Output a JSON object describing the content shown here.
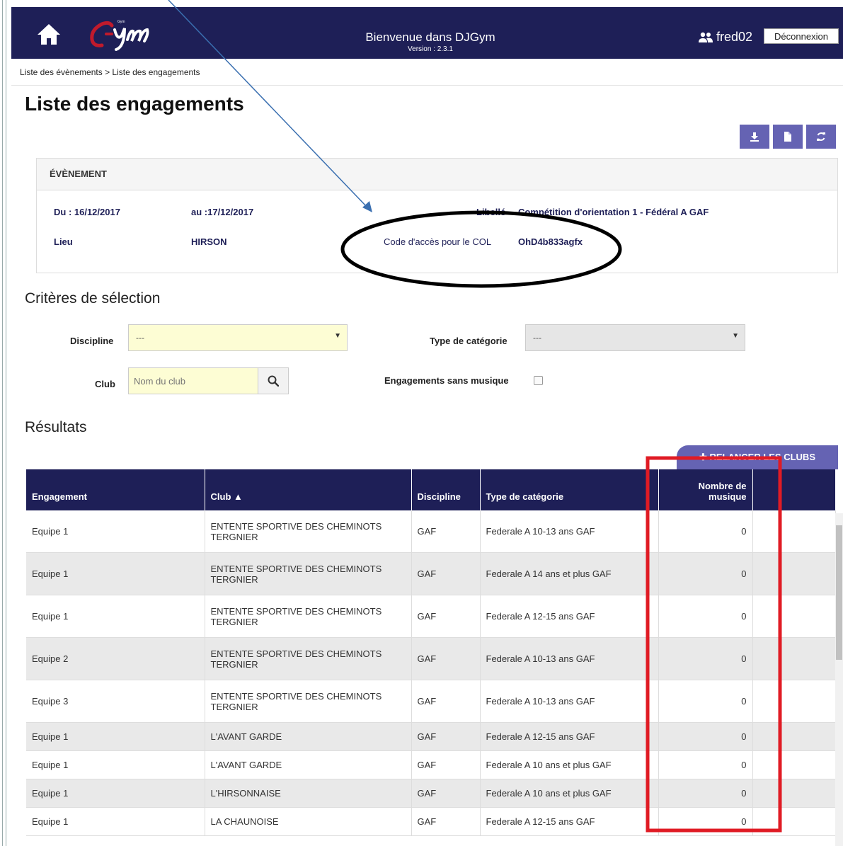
{
  "header": {
    "title": "Bienvenue dans DJGym",
    "version": "Version : 2.3.1",
    "logo_text": "Gym",
    "user": "fred02",
    "logout_label": "Déconnexion"
  },
  "breadcrumb": "Liste des évènements > Liste des engagements",
  "page_title": "Liste des engagements",
  "event": {
    "heading": "ÉVÈNEMENT",
    "du_label": "Du : 16/12/2017",
    "au_label": "au :17/12/2017",
    "libelle_label": "Libellé",
    "libelle_value": "Compétition d'orientation 1 - Fédéral A GAF",
    "lieu_label": "Lieu",
    "lieu_value": "HIRSON",
    "code_label": "Code d'accès pour le COL",
    "code_value": "OhD4b833agfx"
  },
  "criteria": {
    "title": "Critères de sélection",
    "discipline_label": "Discipline",
    "discipline_value": "---",
    "type_label": "Type de catégorie",
    "type_value": "---",
    "club_label": "Club",
    "club_placeholder": "Nom du club",
    "sans_musique_label": "Engagements sans musique"
  },
  "results": {
    "title": "Résultats",
    "relancer_label": "✚ RELANCER LES CLUBS",
    "columns": [
      "Engagement",
      "Club ▲",
      "Discipline",
      "Type de catégorie",
      "Nombre de musique",
      ""
    ],
    "rows": [
      [
        "Equipe 1",
        "ENTENTE SPORTIVE DES CHEMINOTS TERGNIER",
        "GAF",
        "Federale A 10-13 ans GAF",
        "0"
      ],
      [
        "Equipe 1",
        "ENTENTE SPORTIVE DES CHEMINOTS TERGNIER",
        "GAF",
        "Federale A 14 ans et plus GAF",
        "0"
      ],
      [
        "Equipe 1",
        "ENTENTE SPORTIVE DES CHEMINOTS TERGNIER",
        "GAF",
        "Federale A 12-15 ans GAF",
        "0"
      ],
      [
        "Equipe 2",
        "ENTENTE SPORTIVE DES CHEMINOTS TERGNIER",
        "GAF",
        "Federale A 10-13 ans GAF",
        "0"
      ],
      [
        "Equipe 3",
        "ENTENTE SPORTIVE DES CHEMINOTS TERGNIER",
        "GAF",
        "Federale A 10-13 ans GAF",
        "0"
      ],
      [
        "Equipe 1",
        "L'AVANT GARDE",
        "GAF",
        "Federale A 12-15 ans GAF",
        "0"
      ],
      [
        "Equipe 1",
        "L'AVANT GARDE",
        "GAF",
        "Federale A 10 ans et plus GAF",
        "0"
      ],
      [
        "Equipe 1",
        "L'HIRSONNAISE",
        "GAF",
        "Federale A 10 ans et plus GAF",
        "0"
      ],
      [
        "Equipe 1",
        "LA CHAUNOISE",
        "GAF",
        "Federale A 12-15 ans GAF",
        "0"
      ]
    ]
  },
  "colors": {
    "navy": "#1e1f57",
    "accent": "#6563b3",
    "input_yellow": "#fdfdd4",
    "annotation_red": "#e01b24",
    "annotation_arrow": "#3a6fb0"
  },
  "icons": [
    "home-icon",
    "users-icon",
    "download-icon",
    "file-icon",
    "refresh-icon",
    "search-icon",
    "plus-icon"
  ]
}
